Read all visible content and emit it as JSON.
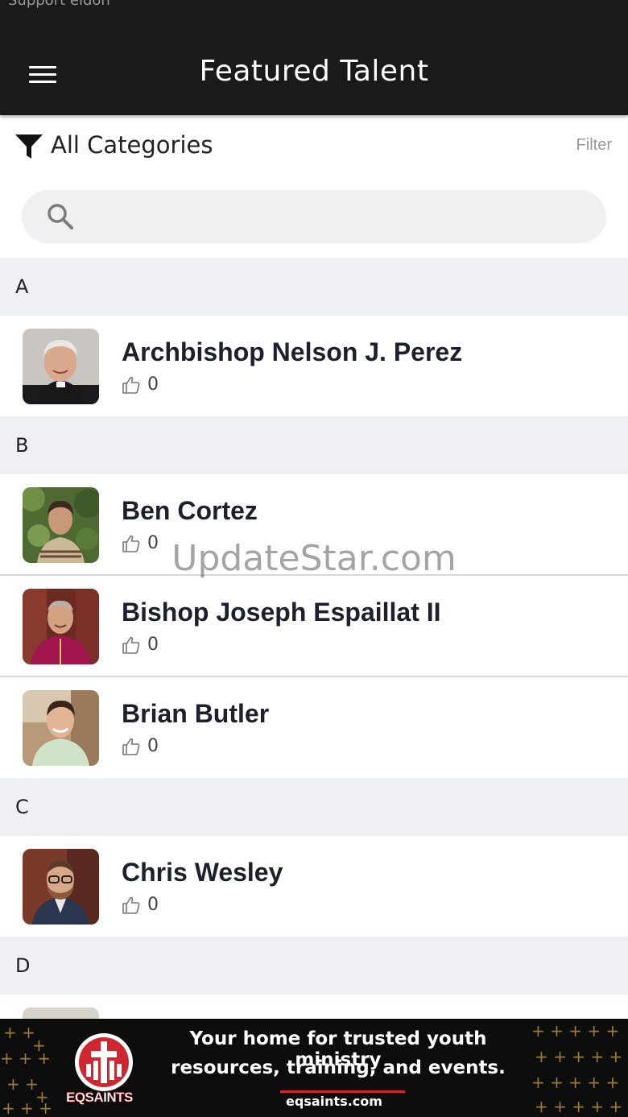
{
  "status_bar": {
    "text": "Support eldon"
  },
  "header": {
    "title": "Featured Talent",
    "menu_icon": "hamburger-menu-icon"
  },
  "filter": {
    "label": "All Categories",
    "link": "Filter",
    "icon": "funnel-icon"
  },
  "search": {
    "placeholder": "",
    "value": "",
    "icon": "search-icon"
  },
  "sections": [
    {
      "letter": "A",
      "people": [
        {
          "name": "Archbishop Nelson J. Perez",
          "likes": "0"
        }
      ]
    },
    {
      "letter": "B",
      "people": [
        {
          "name": "Ben Cortez",
          "likes": "0"
        },
        {
          "name": "Bishop Joseph Espaillat II",
          "likes": "0"
        },
        {
          "name": "Brian Butler",
          "likes": "0"
        }
      ]
    },
    {
      "letter": "C",
      "people": [
        {
          "name": "Chris Wesley",
          "likes": "0"
        }
      ]
    },
    {
      "letter": "D",
      "people": []
    }
  ],
  "watermark": "UpdateStar.com",
  "ad": {
    "brand": "EQSAINTS",
    "line1": "Your home for trusted youth ministry",
    "line2": "resources, training, and events.",
    "url": "eqsaints.com",
    "accent_color": "#d02630"
  }
}
